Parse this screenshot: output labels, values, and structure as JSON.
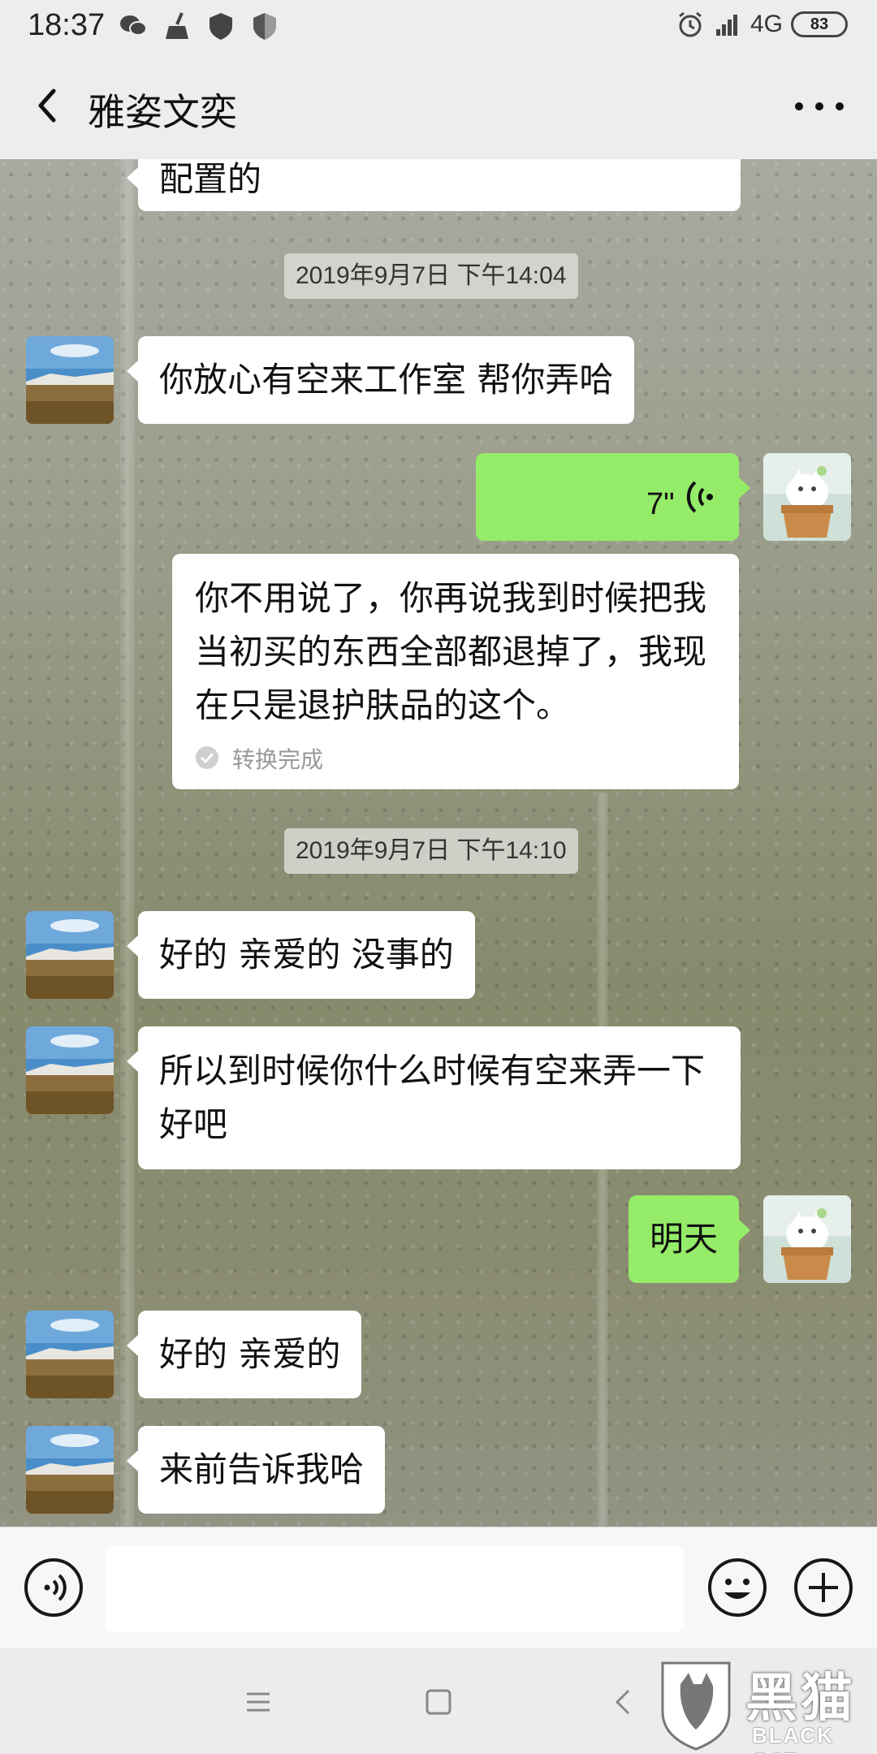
{
  "status_bar": {
    "time": "18:37",
    "network": "4G",
    "battery": "83",
    "left_icons": [
      "wechat-icon",
      "broom-icon",
      "shield-icon",
      "shield-half-icon"
    ],
    "right_icons": [
      "alarm-icon",
      "signal-icon"
    ]
  },
  "header": {
    "title": "雅姿文奕",
    "back_icon": "back-chevron-icon",
    "more_icon": "more-dots-icon"
  },
  "messages": [
    {
      "side": "in",
      "text": "配置的"
    },
    {
      "type": "timestamp",
      "text": "2019年9月7日 下午14:04"
    },
    {
      "side": "in",
      "text": "你放心有空来工作室 帮你弄哈"
    },
    {
      "side": "out",
      "type": "voice",
      "duration": "7\""
    },
    {
      "type": "transcript",
      "text": "你不用说了，你再说我到时候把我当初买的东西全部都退掉了，我现在只是退护肤品的这个。",
      "status": "转换完成"
    },
    {
      "type": "timestamp",
      "text": "2019年9月7日 下午14:10"
    },
    {
      "side": "in",
      "text": "好的 亲爱的 没事的"
    },
    {
      "side": "in",
      "text": "所以到时候你什么时候有空来弄一下好吧"
    },
    {
      "side": "out",
      "text": "明天"
    },
    {
      "side": "in",
      "text": "好的 亲爱的"
    },
    {
      "side": "in",
      "text": "来前告诉我哈"
    }
  ],
  "input_bar": {
    "voice_icon": "voice-mode-icon",
    "emoji_icon": "emoji-icon",
    "plus_icon": "plus-icon",
    "value": ""
  },
  "nav_bar": {
    "icons": [
      "menu-icon",
      "home-square-icon",
      "back-nav-icon"
    ]
  },
  "watermark": {
    "cn": "黑猫",
    "en": "BLACK CAT"
  },
  "colors": {
    "outgoing_bubble": "#95ec69",
    "incoming_bubble": "#ffffff",
    "header_bg": "#ededed"
  }
}
